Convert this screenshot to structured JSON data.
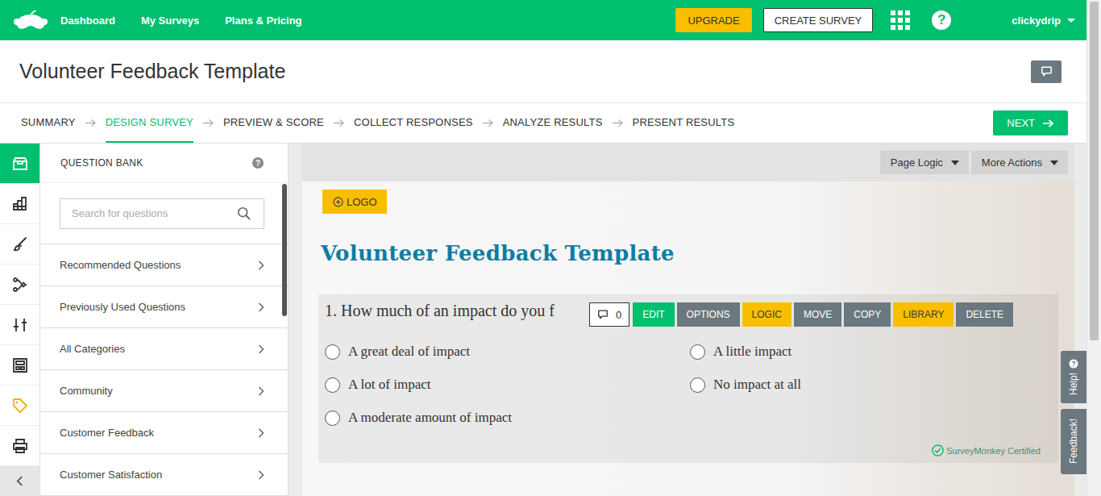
{
  "topbar": {
    "nav": [
      {
        "label": "Dashboard"
      },
      {
        "label": "My Surveys"
      },
      {
        "label": "Plans & Pricing"
      }
    ],
    "upgrade": "UPGRADE",
    "create": "CREATE SURVEY",
    "help": "?",
    "user": "clickydrip"
  },
  "survey_title": "Volunteer Feedback Template",
  "steps": [
    {
      "label": "SUMMARY",
      "selected": false
    },
    {
      "label": "DESIGN SURVEY",
      "selected": true
    },
    {
      "label": "PREVIEW & SCORE",
      "selected": false
    },
    {
      "label": "COLLECT RESPONSES",
      "selected": false
    },
    {
      "label": "ANALYZE RESULTS",
      "selected": false
    },
    {
      "label": "PRESENT RESULTS",
      "selected": false
    }
  ],
  "next": "NEXT",
  "rail": [
    {
      "kind": "bank",
      "selected": true
    },
    {
      "kind": "builder",
      "selected": false
    },
    {
      "kind": "style",
      "selected": false
    },
    {
      "kind": "logic",
      "selected": false
    },
    {
      "kind": "options",
      "selected": false
    },
    {
      "kind": "templates",
      "selected": false
    },
    {
      "kind": "tags",
      "selected": false
    },
    {
      "kind": "print",
      "selected": false
    }
  ],
  "panel": {
    "title": "QUESTION BANK",
    "help": "?",
    "search_placeholder": "Search for questions",
    "items": [
      {
        "label": "Recommended Questions"
      },
      {
        "label": "Previously Used Questions"
      },
      {
        "label": "All Categories"
      },
      {
        "label": "Community"
      },
      {
        "label": "Customer Feedback"
      },
      {
        "label": "Customer Satisfaction"
      }
    ]
  },
  "canvas_toolbar": [
    {
      "label": "Page Logic"
    },
    {
      "label": "More Actions"
    }
  ],
  "survey": {
    "logo_button": "LOGO",
    "title": "Volunteer Feedback Template",
    "question": {
      "text": "1. How much of an impact do you f",
      "comments": "0",
      "actions": [
        {
          "label": "EDIT",
          "color": "#00bf6f"
        },
        {
          "label": "OPTIONS",
          "color": "#6b787f"
        },
        {
          "label": "LOGIC",
          "color": "#f9be00"
        },
        {
          "label": "MOVE",
          "color": "#6b787f"
        },
        {
          "label": "COPY",
          "color": "#6b787f"
        },
        {
          "label": "LIBRARY",
          "color": "#f9be00"
        },
        {
          "label": "DELETE",
          "color": "#6b787f"
        }
      ],
      "choices": [
        {
          "label": "A great deal of impact",
          "selected": false
        },
        {
          "label": "A lot of impact",
          "selected": false
        },
        {
          "label": "A moderate amount of impact",
          "selected": false
        },
        {
          "label": "A little impact",
          "selected": false
        },
        {
          "label": "No impact at all",
          "selected": false
        }
      ],
      "certified": "SurveyMonkey Certified"
    }
  },
  "side_tabs": [
    {
      "label": "Help!",
      "kind": "help"
    },
    {
      "label": "Feedback!",
      "kind": "feedback"
    }
  ]
}
